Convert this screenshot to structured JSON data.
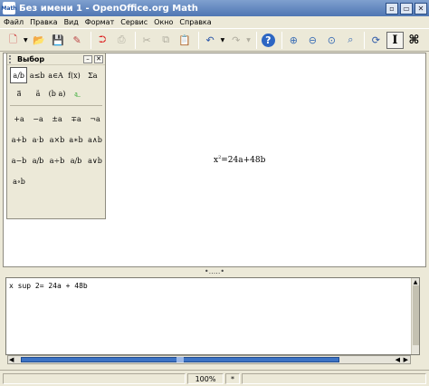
{
  "window": {
    "title": "Без имени 1 - OpenOffice.org Math",
    "app_icon": "Math",
    "controls": [
      "▫",
      "▭",
      "✕"
    ]
  },
  "menu": [
    "Файл",
    "Правка",
    "Вид",
    "Формат",
    "Сервис",
    "Окно",
    "Справка"
  ],
  "toolbar": {
    "icons": [
      {
        "name": "new-document-icon",
        "glyph": "🗋"
      },
      {
        "name": "open-folder-icon",
        "glyph": "📂"
      },
      {
        "name": "save-icon",
        "glyph": "💾"
      },
      {
        "name": "edit-file-icon",
        "glyph": "✎"
      },
      {
        "name": "export-pdf-icon",
        "glyph": "⮊"
      },
      {
        "name": "print-icon",
        "glyph": "⎙"
      },
      {
        "name": "cut-icon",
        "glyph": "✂"
      },
      {
        "name": "copy-icon",
        "glyph": "⧉"
      },
      {
        "name": "paste-icon",
        "glyph": "📋"
      },
      {
        "name": "undo-icon",
        "glyph": "↶"
      },
      {
        "name": "redo-icon",
        "glyph": "↷"
      },
      {
        "name": "help-icon",
        "glyph": "?"
      },
      {
        "name": "zoom-in-icon",
        "glyph": "⊕"
      },
      {
        "name": "zoom-out-icon",
        "glyph": "⊖"
      },
      {
        "name": "zoom-100-icon",
        "glyph": "⊙"
      },
      {
        "name": "zoom-fit-icon",
        "glyph": "⌕"
      },
      {
        "name": "refresh-icon",
        "glyph": "⟳"
      },
      {
        "name": "formula-cursor-icon",
        "glyph": "I"
      },
      {
        "name": "selection-icon",
        "glyph": "⌘"
      }
    ]
  },
  "selection_panel": {
    "title": "Выбор",
    "categories_row1": [
      "a/b",
      "a≤b",
      "a∈A",
      "f(x)",
      "Σa"
    ],
    "categories_row2": [
      "a⃗",
      "ä",
      "(b a)",
      "a͟"
    ],
    "symbols": [
      "+a",
      "−a",
      "±a",
      "∓a",
      "¬a",
      "a+b",
      "a·b",
      "a×b",
      "a∗b",
      "a∧b",
      "a−b",
      "a/b",
      "a÷b",
      "a/b",
      "a∨b",
      "a∘b"
    ]
  },
  "formula_preview": {
    "base": "x",
    "sup": "2",
    "rest": "=24a+48b"
  },
  "splitter_label": "•.....•",
  "command": {
    "text": "x sup 2= 24a + 48b"
  },
  "status": {
    "zoom": "100%",
    "star": "*"
  }
}
